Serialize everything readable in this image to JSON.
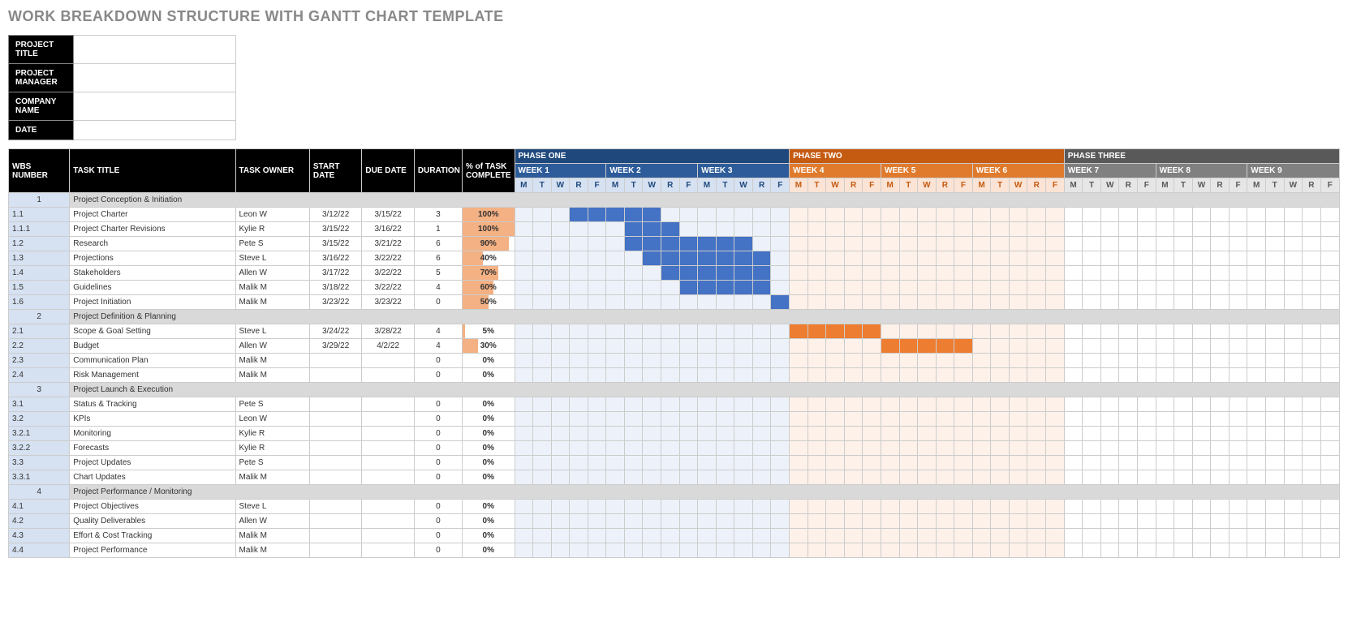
{
  "title": "WORK BREAKDOWN STRUCTURE WITH GANTT CHART TEMPLATE",
  "meta_labels": {
    "project_title": "PROJECT TITLE",
    "project_manager": "PROJECT MANAGER",
    "company_name": "COMPANY NAME",
    "date": "DATE"
  },
  "columns": {
    "wbs": "WBS NUMBER",
    "title": "TASK TITLE",
    "owner": "TASK OWNER",
    "start": "START DATE",
    "due": "DUE DATE",
    "duration": "DURATION",
    "pct": "% of TASK COMPLETE"
  },
  "phases": [
    {
      "label": "PHASE ONE",
      "class": "phase1",
      "weeks": [
        "WEEK 1",
        "WEEK 2",
        "WEEK 3"
      ],
      "wclass": "week1",
      "dclass": "day1",
      "bg": "bg1"
    },
    {
      "label": "PHASE TWO",
      "class": "phase2",
      "weeks": [
        "WEEK 4",
        "WEEK 5",
        "WEEK 6"
      ],
      "wclass": "week2",
      "dclass": "day2",
      "bg": "bg2"
    },
    {
      "label": "PHASE THREE",
      "class": "phase3",
      "weeks": [
        "WEEK 7",
        "WEEK 8",
        "WEEK 9"
      ],
      "wclass": "week3",
      "dclass": "day3",
      "bg": "bg3"
    }
  ],
  "days": [
    "M",
    "T",
    "W",
    "R",
    "F"
  ],
  "rows": [
    {
      "section": true,
      "wbs": "1",
      "title": "Project Conception & Initiation"
    },
    {
      "wbs": "1.1",
      "title": "Project Charter",
      "owner": "Leon W",
      "start": "3/12/22",
      "due": "3/15/22",
      "dur": "3",
      "pct": 100,
      "bars": [
        [
          4,
          8,
          "1"
        ]
      ]
    },
    {
      "wbs": "1.1.1",
      "title": "Project Charter Revisions",
      "owner": "Kylie R",
      "start": "3/15/22",
      "due": "3/16/22",
      "dur": "1",
      "pct": 100,
      "bars": [
        [
          7,
          9,
          "1"
        ]
      ]
    },
    {
      "wbs": "1.2",
      "title": "Research",
      "owner": "Pete S",
      "start": "3/15/22",
      "due": "3/21/22",
      "dur": "6",
      "pct": 90,
      "bars": [
        [
          7,
          13,
          "1"
        ]
      ]
    },
    {
      "wbs": "1.3",
      "title": "Projections",
      "owner": "Steve L",
      "start": "3/16/22",
      "due": "3/22/22",
      "dur": "6",
      "pct": 40,
      "bars": [
        [
          8,
          14,
          "1"
        ]
      ]
    },
    {
      "wbs": "1.4",
      "title": "Stakeholders",
      "owner": "Allen W",
      "start": "3/17/22",
      "due": "3/22/22",
      "dur": "5",
      "pct": 70,
      "bars": [
        [
          9,
          14,
          "1"
        ]
      ]
    },
    {
      "wbs": "1.5",
      "title": "Guidelines",
      "owner": "Malik M",
      "start": "3/18/22",
      "due": "3/22/22",
      "dur": "4",
      "pct": 60,
      "bars": [
        [
          10,
          14,
          "1"
        ]
      ]
    },
    {
      "wbs": "1.6",
      "title": "Project Initiation",
      "owner": "Malik M",
      "start": "3/23/22",
      "due": "3/23/22",
      "dur": "0",
      "pct": 50,
      "bars": [
        [
          15,
          15,
          "1"
        ]
      ]
    },
    {
      "section": true,
      "wbs": "2",
      "title": "Project Definition & Planning"
    },
    {
      "wbs": "2.1",
      "title": "Scope & Goal Setting",
      "owner": "Steve L",
      "start": "3/24/22",
      "due": "3/28/22",
      "dur": "4",
      "pct": 5,
      "bars": [
        [
          16,
          20,
          "2"
        ]
      ]
    },
    {
      "wbs": "2.2",
      "title": "Budget",
      "owner": "Allen W",
      "start": "3/29/22",
      "due": "4/2/22",
      "dur": "4",
      "pct": 30,
      "bars": [
        [
          21,
          25,
          "2"
        ]
      ]
    },
    {
      "wbs": "2.3",
      "title": "Communication Plan",
      "owner": "Malik M",
      "start": "",
      "due": "",
      "dur": "0",
      "pct": 0,
      "bars": []
    },
    {
      "wbs": "2.4",
      "title": "Risk Management",
      "owner": "Malik M",
      "start": "",
      "due": "",
      "dur": "0",
      "pct": 0,
      "bars": []
    },
    {
      "section": true,
      "wbs": "3",
      "title": "Project Launch & Execution"
    },
    {
      "wbs": "3.1",
      "title": "Status & Tracking",
      "owner": "Pete S",
      "start": "",
      "due": "",
      "dur": "0",
      "pct": 0,
      "bars": []
    },
    {
      "wbs": "3.2",
      "title": "KPIs",
      "owner": "Leon W",
      "start": "",
      "due": "",
      "dur": "0",
      "pct": 0,
      "bars": []
    },
    {
      "wbs": "3.2.1",
      "title": "Monitoring",
      "owner": "Kylie R",
      "start": "",
      "due": "",
      "dur": "0",
      "pct": 0,
      "bars": []
    },
    {
      "wbs": "3.2.2",
      "title": "Forecasts",
      "owner": "Kylie R",
      "start": "",
      "due": "",
      "dur": "0",
      "pct": 0,
      "bars": []
    },
    {
      "wbs": "3.3",
      "title": "Project Updates",
      "owner": "Pete S",
      "start": "",
      "due": "",
      "dur": "0",
      "pct": 0,
      "bars": []
    },
    {
      "wbs": "3.3.1",
      "title": "Chart Updates",
      "owner": "Malik M",
      "start": "",
      "due": "",
      "dur": "0",
      "pct": 0,
      "bars": []
    },
    {
      "section": true,
      "wbs": "4",
      "title": "Project Performance / Monitoring"
    },
    {
      "wbs": "4.1",
      "title": "Project Objectives",
      "owner": "Steve L",
      "start": "",
      "due": "",
      "dur": "0",
      "pct": 0,
      "bars": []
    },
    {
      "wbs": "4.2",
      "title": "Quality Deliverables",
      "owner": "Allen W",
      "start": "",
      "due": "",
      "dur": "0",
      "pct": 0,
      "bars": []
    },
    {
      "wbs": "4.3",
      "title": "Effort & Cost Tracking",
      "owner": "Malik M",
      "start": "",
      "due": "",
      "dur": "0",
      "pct": 0,
      "bars": []
    },
    {
      "wbs": "4.4",
      "title": "Project Performance",
      "owner": "Malik M",
      "start": "",
      "due": "",
      "dur": "0",
      "pct": 0,
      "bars": []
    }
  ],
  "chart_data": {
    "type": "gantt",
    "title": "Work Breakdown Structure with Gantt Chart",
    "x_unit": "workdays (M-F)",
    "phases": [
      "PHASE ONE (weeks 1-3)",
      "PHASE TWO (weeks 4-6)",
      "PHASE THREE (weeks 7-9)"
    ],
    "weeks": [
      "WEEK 1",
      "WEEK 2",
      "WEEK 3",
      "WEEK 4",
      "WEEK 5",
      "WEEK 6",
      "WEEK 7",
      "WEEK 8",
      "WEEK 9"
    ],
    "series": [
      {
        "wbs": "1.1",
        "task": "Project Charter",
        "owner": "Leon W",
        "start": "3/12/22",
        "due": "3/15/22",
        "duration_days": 3,
        "pct_complete": 100,
        "phase": 1,
        "bar_day_index": [
          4,
          8
        ]
      },
      {
        "wbs": "1.1.1",
        "task": "Project Charter Revisions",
        "owner": "Kylie R",
        "start": "3/15/22",
        "due": "3/16/22",
        "duration_days": 1,
        "pct_complete": 100,
        "phase": 1,
        "bar_day_index": [
          7,
          9
        ]
      },
      {
        "wbs": "1.2",
        "task": "Research",
        "owner": "Pete S",
        "start": "3/15/22",
        "due": "3/21/22",
        "duration_days": 6,
        "pct_complete": 90,
        "phase": 1,
        "bar_day_index": [
          7,
          13
        ]
      },
      {
        "wbs": "1.3",
        "task": "Projections",
        "owner": "Steve L",
        "start": "3/16/22",
        "due": "3/22/22",
        "duration_days": 6,
        "pct_complete": 40,
        "phase": 1,
        "bar_day_index": [
          8,
          14
        ]
      },
      {
        "wbs": "1.4",
        "task": "Stakeholders",
        "owner": "Allen W",
        "start": "3/17/22",
        "due": "3/22/22",
        "duration_days": 5,
        "pct_complete": 70,
        "phase": 1,
        "bar_day_index": [
          9,
          14
        ]
      },
      {
        "wbs": "1.5",
        "task": "Guidelines",
        "owner": "Malik M",
        "start": "3/18/22",
        "due": "3/22/22",
        "duration_days": 4,
        "pct_complete": 60,
        "phase": 1,
        "bar_day_index": [
          10,
          14
        ]
      },
      {
        "wbs": "1.6",
        "task": "Project Initiation",
        "owner": "Malik M",
        "start": "3/23/22",
        "due": "3/23/22",
        "duration_days": 0,
        "pct_complete": 50,
        "phase": 1,
        "bar_day_index": [
          15,
          15
        ]
      },
      {
        "wbs": "2.1",
        "task": "Scope & Goal Setting",
        "owner": "Steve L",
        "start": "3/24/22",
        "due": "3/28/22",
        "duration_days": 4,
        "pct_complete": 5,
        "phase": 2,
        "bar_day_index": [
          16,
          20
        ]
      },
      {
        "wbs": "2.2",
        "task": "Budget",
        "owner": "Allen W",
        "start": "3/29/22",
        "due": "4/2/22",
        "duration_days": 4,
        "pct_complete": 30,
        "phase": 2,
        "bar_day_index": [
          21,
          25
        ]
      },
      {
        "wbs": "2.3",
        "task": "Communication Plan",
        "owner": "Malik M",
        "duration_days": 0,
        "pct_complete": 0,
        "phase": 2
      },
      {
        "wbs": "2.4",
        "task": "Risk Management",
        "owner": "Malik M",
        "duration_days": 0,
        "pct_complete": 0,
        "phase": 2
      },
      {
        "wbs": "3.1",
        "task": "Status & Tracking",
        "owner": "Pete S",
        "duration_days": 0,
        "pct_complete": 0,
        "phase": 3
      },
      {
        "wbs": "3.2",
        "task": "KPIs",
        "owner": "Leon W",
        "duration_days": 0,
        "pct_complete": 0,
        "phase": 3
      },
      {
        "wbs": "3.2.1",
        "task": "Monitoring",
        "owner": "Kylie R",
        "duration_days": 0,
        "pct_complete": 0,
        "phase": 3
      },
      {
        "wbs": "3.2.2",
        "task": "Forecasts",
        "owner": "Kylie R",
        "duration_days": 0,
        "pct_complete": 0,
        "phase": 3
      },
      {
        "wbs": "3.3",
        "task": "Project Updates",
        "owner": "Pete S",
        "duration_days": 0,
        "pct_complete": 0,
        "phase": 3
      },
      {
        "wbs": "3.3.1",
        "task": "Chart Updates",
        "owner": "Malik M",
        "duration_days": 0,
        "pct_complete": 0,
        "phase": 3
      },
      {
        "wbs": "4.1",
        "task": "Project Objectives",
        "owner": "Steve L",
        "duration_days": 0,
        "pct_complete": 0,
        "phase": 3
      },
      {
        "wbs": "4.2",
        "task": "Quality Deliverables",
        "owner": "Allen W",
        "duration_days": 0,
        "pct_complete": 0,
        "phase": 3
      },
      {
        "wbs": "4.3",
        "task": "Effort & Cost Tracking",
        "owner": "Malik M",
        "duration_days": 0,
        "pct_complete": 0,
        "phase": 3
      },
      {
        "wbs": "4.4",
        "task": "Project Performance",
        "owner": "Malik M",
        "duration_days": 0,
        "pct_complete": 0,
        "phase": 3
      }
    ]
  }
}
